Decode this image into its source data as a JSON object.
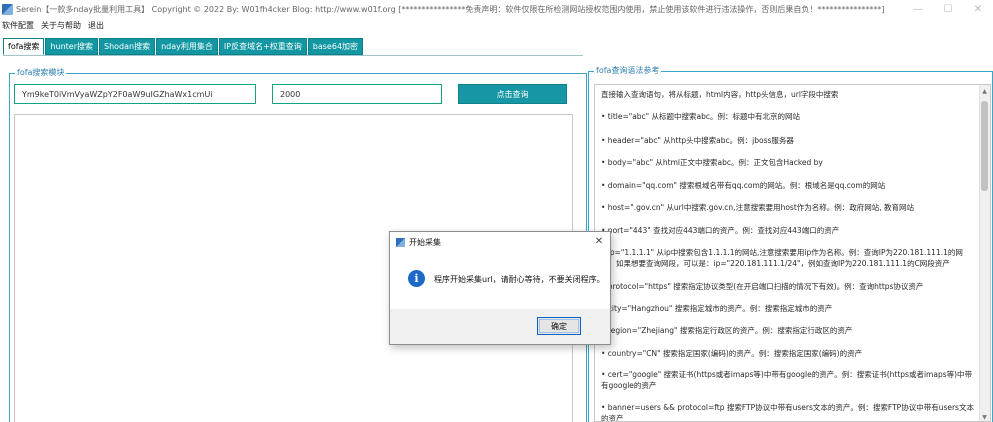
{
  "window": {
    "title": "Serein【一款多nday批量利用工具】 Copyright © 2022 By: W01fh4cker Blog: http://www.w01f.org [****************免责声明：软件仅限在所检测网站授权范围内使用，禁止使用该软件进行违法操作，否则后果自负！****************]",
    "minimize_glyph": "—",
    "maximize_glyph": "☐",
    "close_glyph": "✕"
  },
  "menu": [
    "软件配置",
    "关于与帮助",
    "退出"
  ],
  "tabs": [
    "fofa搜索",
    "hunter搜索",
    "Shodan搜索",
    "nday利用集合",
    "IP反查域名+权重查询",
    "base64加密"
  ],
  "search_module": {
    "legend": "fofa搜索模块",
    "query_value": "Ym9keT0iVmVyaWZpY2F0aW9uIGZhaWx1cmUi",
    "count_value": "2000",
    "button_label": "点击查询"
  },
  "reference": {
    "legend": "fofa查询语法参考",
    "lines": [
      "直接输入查询语句，将从标题，html内容，http头信息，url字段中搜索",
      "• title=\"abc\" 从标题中搜索abc。例：标题中有北京的网站",
      "• header=\"abc\" 从http头中搜索abc。例：jboss服务器",
      "• body=\"abc\" 从html正文中搜索abc。例：正文包含Hacked by",
      "• domain=\"qq.com\" 搜索根域名带有qq.com的网站。例：根域名是qq.com的网站",
      "• host=\".gov.cn\" 从url中搜索.gov.cn,注意搜索要用host作为名称。例：政府网站, 教育网站",
      "• port=\"443\" 查找对应443端口的资产。例：查找对应443端口的资产",
      "• ip=\"1.1.1.1\" 从ip中搜索包含1.1.1.1的网站,注意搜索要用ip作为名称。例：查询IP为220.181.111.1的网站；如果想要查询网段，可以是：ip=\"220.181.111.1/24\"，例如查询IP为220.181.111.1的C网段资产",
      "• protocol=\"https\" 搜索指定协议类型(在开启端口扫描的情况下有效)。例：查询https协议资产",
      "• city=\"Hangzhou\" 搜索指定城市的资产。例：搜索指定城市的资产",
      "• region=\"Zhejiang\" 搜索指定行政区的资产。例：搜索指定行政区的资产",
      "• country=\"CN\" 搜索指定国家(编码)的资产。例：搜索指定国家(编码)的资产",
      "• cert=\"google\" 搜索证书(https或者imaps等)中带有google的资产。例：搜索证书(https或者imaps等)中带有google的资产",
      "• banner=users && protocol=ftp 搜索FTP协议中带有users文本的资产。例：搜索FTP协议中带有users文本的资产"
    ],
    "scroll_up_glyph": "▲",
    "scroll_down_glyph": "▼"
  },
  "dialog": {
    "title": "开始采集",
    "icon_glyph": "i",
    "close_glyph": "✕",
    "message": "程序开始采集url，请耐心等待，不要关闭程序。",
    "ok_label": "确定"
  },
  "colors": {
    "tab_bg": "#1297a3",
    "button_bg": "#1797a6",
    "group_border": "#3aa6c8",
    "info_blue": "#1d69c8"
  }
}
